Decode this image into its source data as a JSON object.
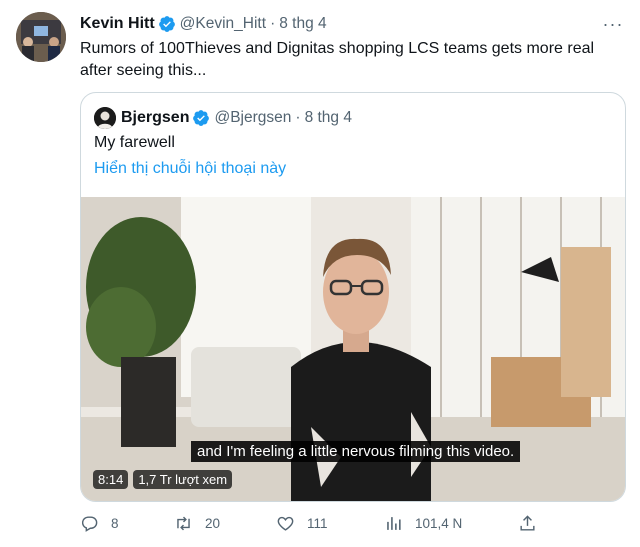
{
  "author": {
    "name": "Kevin Hitt",
    "handle": "@Kevin_Hitt",
    "date": "8 thg 4",
    "verified_icon": "verified-badge-icon",
    "avatar_icon": "avatar"
  },
  "tweet": {
    "text": "Rumors of 100Thieves and Dignitas shopping LCS teams gets more real after seeing this..."
  },
  "quoted": {
    "name": "Bjergsen",
    "handle": "@Bjergsen",
    "date": "8 thg 4",
    "text": "My farewell",
    "thread_link": "Hiển thị chuỗi hội thoại này",
    "video": {
      "caption": "and I'm feeling a little nervous filming this video.",
      "duration": "8:14",
      "views": "1,7 Tr lượt xem"
    }
  },
  "actions": {
    "replies": "8",
    "retweets": "20",
    "likes": "111",
    "views": "101,4 N"
  },
  "colors": {
    "link": "#1d9bf0",
    "muted": "#536471",
    "border": "#cfd9de",
    "verified": "#1d9bf0"
  },
  "ui": {
    "dot": "·",
    "more": "···"
  }
}
